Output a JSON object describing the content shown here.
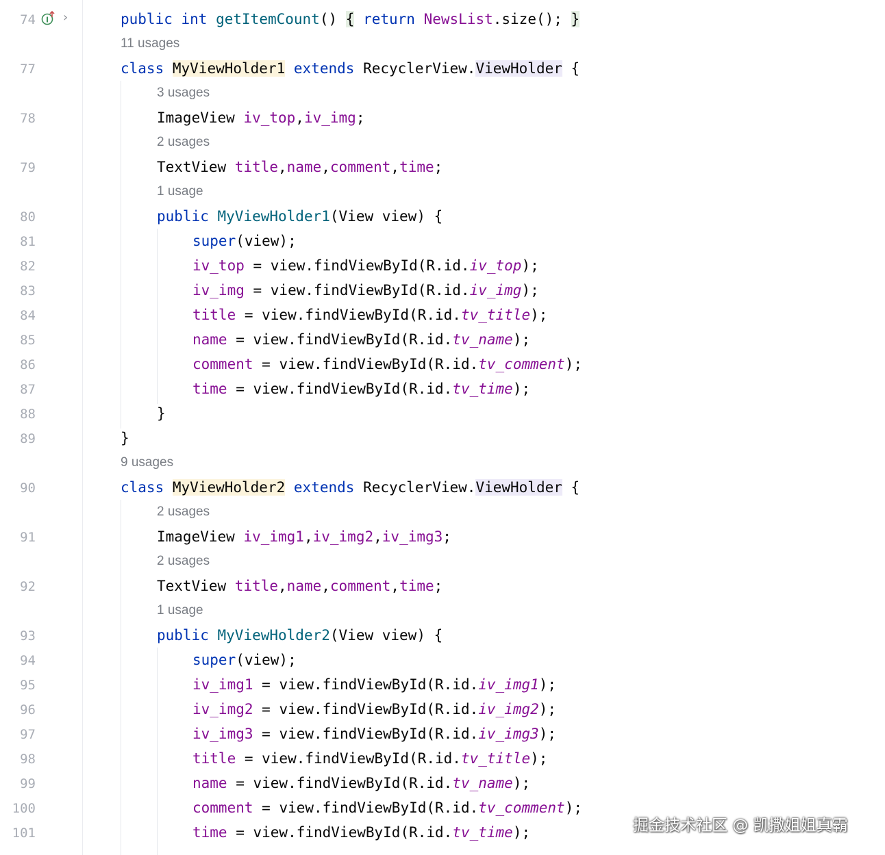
{
  "editor": {
    "line_numbers": [
      "74",
      "77",
      "78",
      "79",
      "80",
      "81",
      "82",
      "83",
      "84",
      "85",
      "86",
      "87",
      "88",
      "89",
      "90",
      "91",
      "92",
      "93",
      "94",
      "95",
      "96",
      "97",
      "98",
      "99",
      "100",
      "101"
    ],
    "hints": {
      "h77": "11 usages",
      "h78": "3 usages",
      "h79": "2 usages",
      "h80": "1 usage",
      "h90": "9 usages",
      "h91": "2 usages",
      "h92": "2 usages",
      "h93": "1 usage"
    },
    "tokens": {
      "public": "public",
      "int": "int",
      "getItemCount": "getItemCount",
      "parens_space": "() ",
      "brace_open": "{",
      "return": "return",
      "NewsList": "NewsList",
      "size_call": ".size(); ",
      "brace_close": "}",
      "class": "class",
      "MyViewHolder1": "MyViewHolder1",
      "MyViewHolder2": "MyViewHolder2",
      "extends": "extends",
      "RecyclerView_dot": "RecyclerView.",
      "ViewHolder": "ViewHolder",
      "ImageView": "ImageView ",
      "TextView": "TextView ",
      "iv_top": "iv_top",
      "iv_img": "iv_img",
      "iv_img1": "iv_img1",
      "iv_img2": "iv_img2",
      "iv_img3": "iv_img3",
      "title": "title",
      "name": "name",
      "comment": "comment",
      "time": "time",
      "comma": ",",
      "semi": ";",
      "ctor_params": "(View view) {",
      "super": "super",
      "super_args": "(view);",
      "assign_find": " = view.findViewById(R.id.",
      "tv_title": "tv_title",
      "tv_name": "tv_name",
      "tv_comment": "tv_comment",
      "tv_time": "tv_time",
      "close_semi": ");",
      "rbrace": "}"
    },
    "watermark": "掘金技术社区 @ 凯撒姐姐真霸",
    "colors": {
      "keyword": "#0033b3",
      "method": "#00627a",
      "field": "#871094",
      "hint": "#7a7e85",
      "gutter_number": "#a9adb5"
    }
  }
}
